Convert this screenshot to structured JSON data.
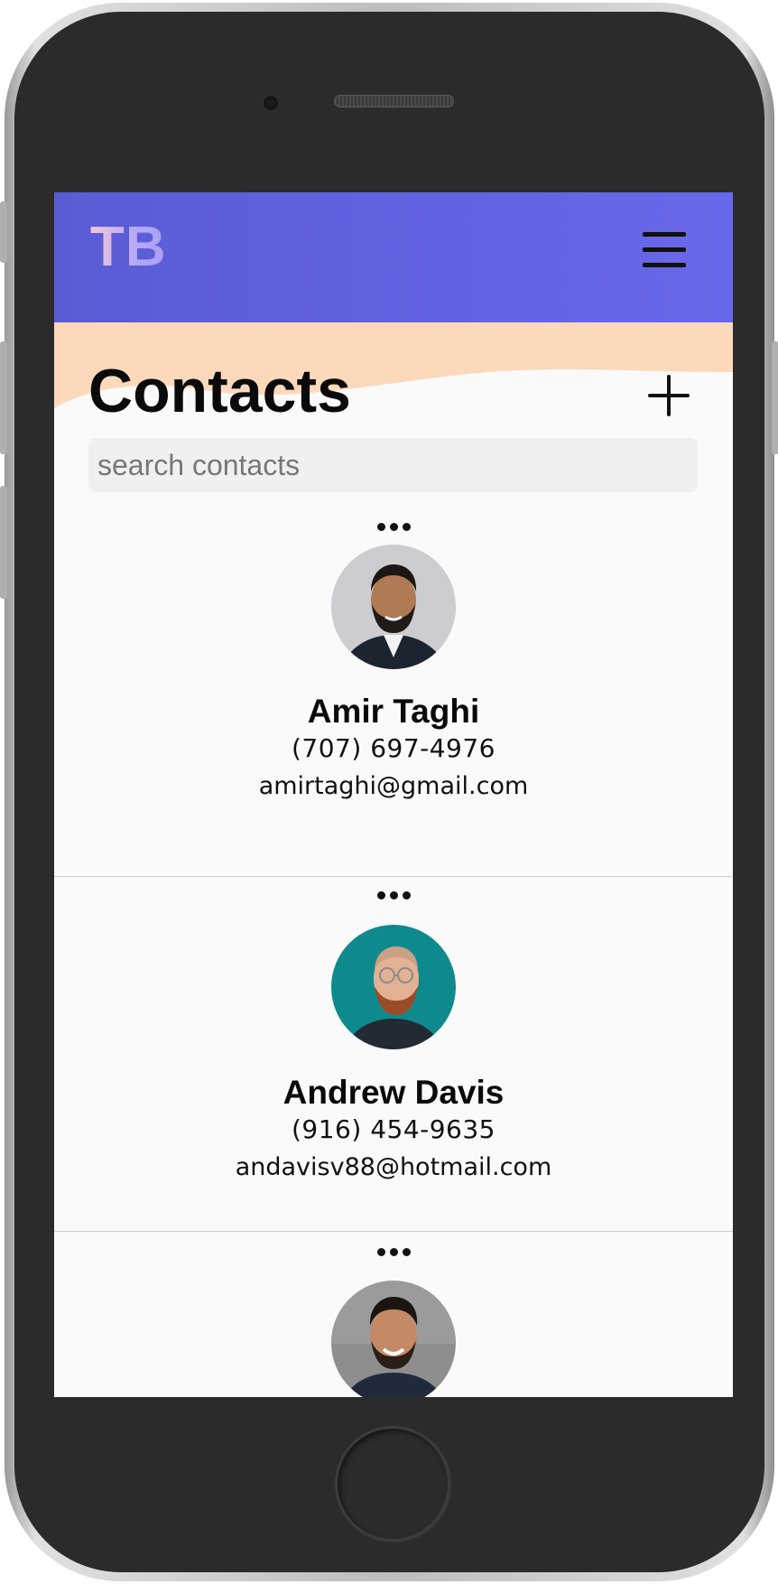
{
  "header": {
    "logo_text": "TB",
    "menu_icon": "hamburger-menu-icon"
  },
  "page": {
    "title": "Contacts",
    "add_icon": "plus-icon"
  },
  "search": {
    "placeholder": "search contacts",
    "value": ""
  },
  "contacts": [
    {
      "name": "Amir Taghi",
      "phone": "(707) 697-4976",
      "email": "amirtaghi@gmail.com"
    },
    {
      "name": "Andrew Davis",
      "phone": "(916) 454-9635",
      "email": "andavisv88@hotmail.com"
    },
    {
      "name": "",
      "phone": "",
      "email": ""
    }
  ],
  "colors": {
    "header_start": "#5b5cd4",
    "header_end": "#6868ea",
    "wave": "#fdd9bb",
    "background": "#fafafa"
  }
}
